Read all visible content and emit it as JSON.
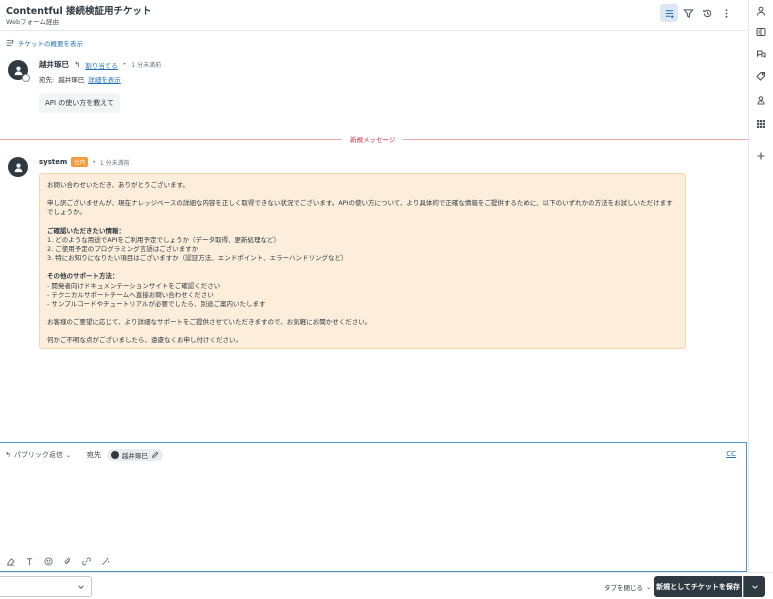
{
  "header": {
    "title": "Contentful 接続検証用チケット",
    "subtitle": "Webフォーム経由"
  },
  "summary_toggle": "チケットの概要を表示",
  "message1": {
    "author": "越井琢巳",
    "assign_label": "割り当てる",
    "time": "1 分未満前",
    "to_prefix": "宛先:",
    "to_name": "越井琢巳",
    "detail_link": "詳細を表示",
    "body": "API の使い方を教えて"
  },
  "new_message_label": "新規メッセージ",
  "message2": {
    "author": "system",
    "internal_badge": "社内",
    "time": "1 分未満前",
    "lines": [
      "お問い合わせいただき、ありがとうございます。",
      "申し訳ございませんが、現在ナレッジベースの詳細な内容を正しく取得できない状況でございます。APIの使い方について、より具体的で正確な情報をご提供するために、以下のいずれかの方法をお試しいただけますでしょうか。",
      "ご確認いただきたい情報：",
      "1. どのような用途でAPIをご利用予定でしょうか（データ取得、更新処理など）",
      "2. ご使用予定のプログラミング言語はございますか",
      "3. 特にお知りになりたい項目はございますか（認証方法、エンドポイント、エラーハンドリングなど）",
      "その他のサポート方法：",
      "- 開発者向けドキュメンテーションサイトをご確認ください",
      "- テクニカルサポートチームへ直接お問い合わせください",
      "- サンプルコードやチュートリアルが必要でしたら、別途ご案内いたします",
      "お客様のご要望に応じて、より詳細なサポートをご提供させていただきますので、お気軽にお聞かせください。",
      "何かご不明な点がございましたら、遠慮なくお申し付けください。"
    ]
  },
  "composer": {
    "reply_type": "パブリック返信",
    "to_label": "宛先",
    "recipient": "越井琢巳",
    "cc_label": "CC"
  },
  "bottom": {
    "close_tab": "タブを閉じる",
    "submit": "新規としてチケットを保存"
  }
}
